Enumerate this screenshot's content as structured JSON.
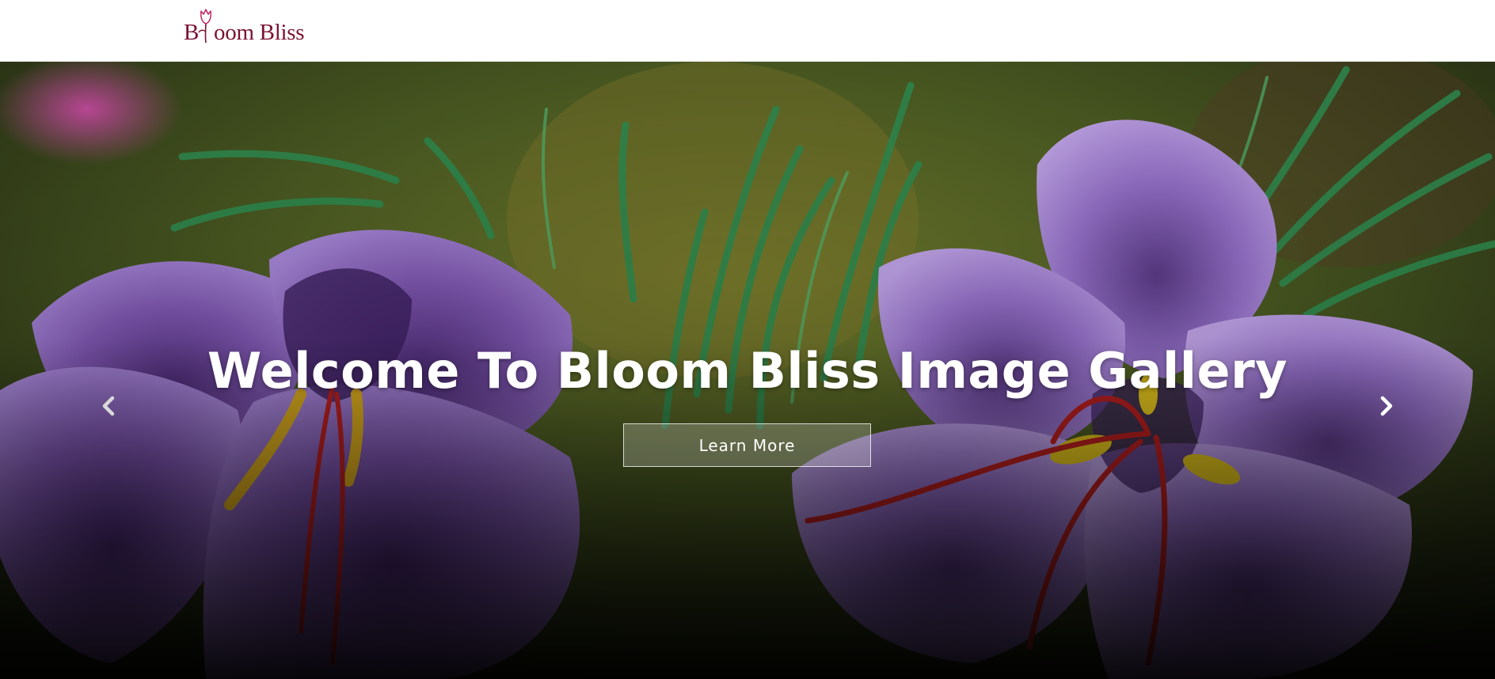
{
  "header": {
    "logo": {
      "initial": "B",
      "rest": "oom Bliss",
      "full_text": "Bloom Bliss",
      "icon": "tulip-icon",
      "color": "#7a1230"
    }
  },
  "hero": {
    "title": "Welcome To Bloom Bliss Image Gallery",
    "button_label": "Learn More",
    "prev_icon": "chevron-left-icon",
    "next_icon": "chevron-right-icon",
    "background": "purple crocus flowers with green leaves"
  },
  "colors": {
    "brand": "#7a1230",
    "text_on_hero": "#ffffff",
    "petal": "#9a6bc8",
    "leaf": "#2f8a4f"
  }
}
